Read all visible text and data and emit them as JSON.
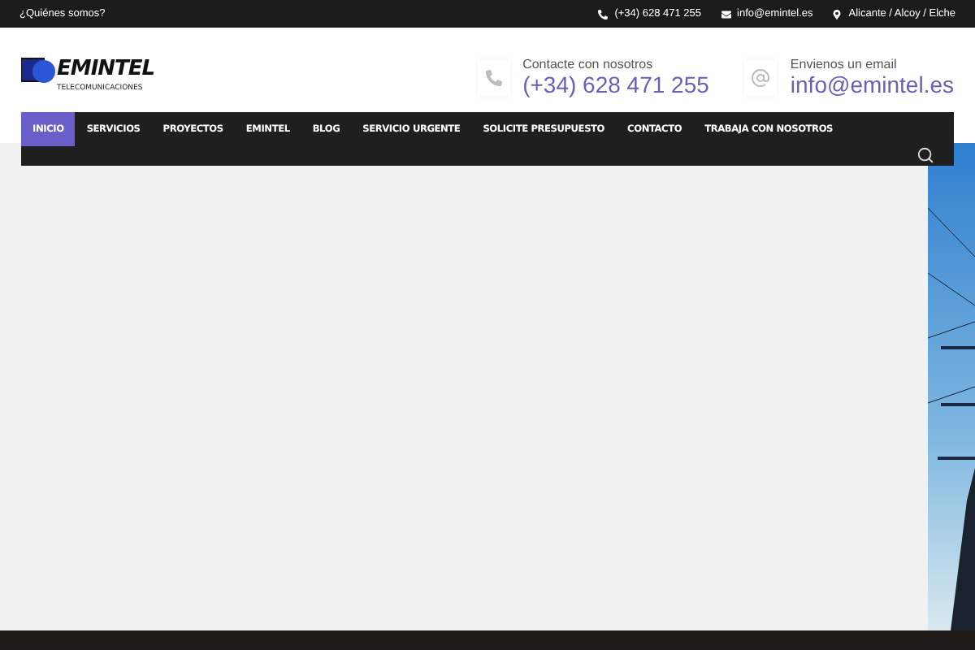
{
  "top_bar": {
    "link": "¿Quiénes somos?",
    "contacts": [
      {
        "kind": "phone",
        "text": "(+34) 628 471 255"
      },
      {
        "kind": "mail",
        "text": "info@emintel.es"
      },
      {
        "kind": "pin",
        "text": "Alicante / Alcoy / Elche"
      }
    ]
  },
  "logo": {
    "text": "EMINTEL",
    "tagline": "TELECOMUNICACIONES"
  },
  "header_contacts": [
    {
      "kind": "phone",
      "label": "Contacte con nosotros",
      "value": "(+34) 628 471 255"
    },
    {
      "kind": "mail",
      "label": "Envienos un email",
      "value": "info@emintel.es"
    }
  ],
  "nav": [
    {
      "label": "INICIO",
      "selected": true
    },
    {
      "label": "SERVICIOS",
      "selected": false
    },
    {
      "label": "PROYECTOS",
      "selected": false
    },
    {
      "label": "EMINTEL",
      "selected": false
    },
    {
      "label": "BLOG",
      "selected": false
    },
    {
      "label": "SERVICIO URGENTE",
      "selected": false
    },
    {
      "label": "SOLICITE PRESUPUESTO",
      "selected": false
    },
    {
      "label": "CONTACTO",
      "selected": false
    },
    {
      "label": "TRABAJA CON NOSOTROS",
      "selected": false
    }
  ]
}
